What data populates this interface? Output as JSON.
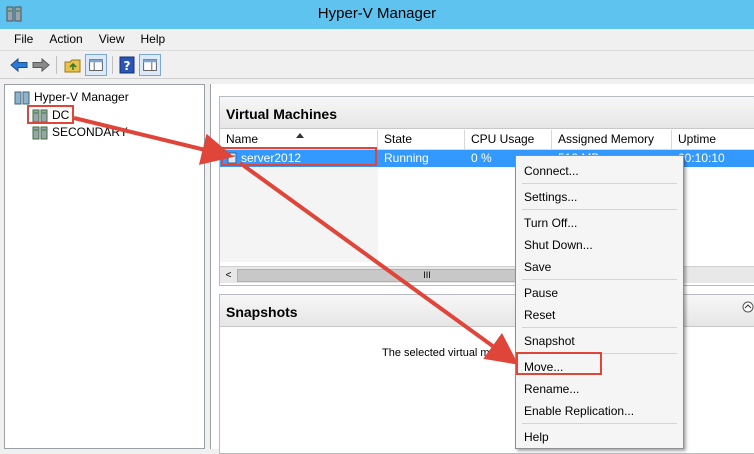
{
  "window": {
    "title": "Hyper-V Manager",
    "app_icon": "hyper-v-server-icon"
  },
  "menu": {
    "items": [
      "File",
      "Action",
      "View",
      "Help"
    ]
  },
  "toolbar": {
    "icons": [
      "back-arrow-icon",
      "forward-arrow-icon",
      "up-folder-icon",
      "show-hide-tree-icon",
      "help-icon",
      "action-pane-icon"
    ]
  },
  "tree": {
    "root": "Hyper-V Manager",
    "servers": [
      "DC",
      "SECONDARY"
    ]
  },
  "vm_panel": {
    "title": "Virtual Machines",
    "columns": [
      "Name",
      "State",
      "CPU Usage",
      "Assigned Memory",
      "Uptime"
    ],
    "rows": [
      {
        "name": "server2012",
        "state": "Running",
        "cpu": "0 %",
        "memory": "512 MB",
        "uptime": "00:10:10"
      }
    ],
    "scroll_mid": "III"
  },
  "snapshots_panel": {
    "title": "Snapshots",
    "message": "The selected virtual ma"
  },
  "context_menu": {
    "items": [
      "Connect...",
      "Settings...",
      "Turn Off...",
      "Shut Down...",
      "Save",
      "Pause",
      "Reset",
      "Snapshot",
      "Move...",
      "Rename...",
      "Enable Replication...",
      "Help"
    ]
  },
  "annotation": {
    "color": "#e0453a"
  },
  "colors": {
    "titlebar": "#5fc3f0",
    "selection": "#3399ff"
  }
}
